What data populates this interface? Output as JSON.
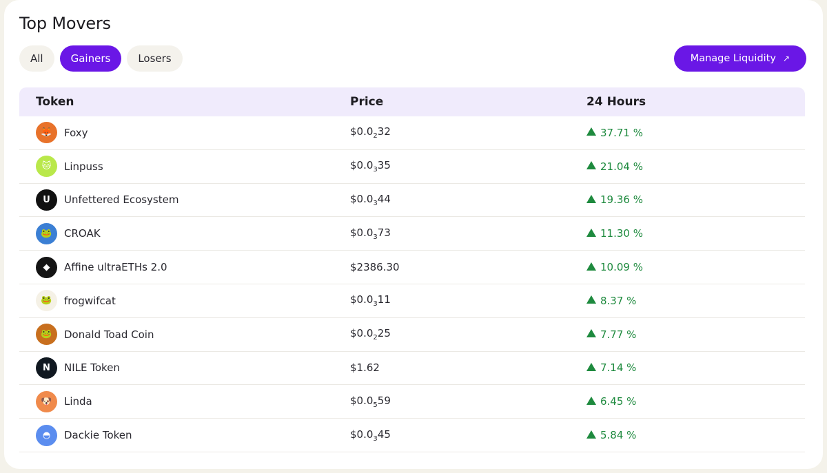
{
  "header": {
    "title": "Top Movers"
  },
  "tabs": [
    {
      "label": "All",
      "active": false
    },
    {
      "label": "Gainers",
      "active": true
    },
    {
      "label": "Losers",
      "active": false
    }
  ],
  "manage_button": {
    "label": "Manage Liquidity",
    "icon": "arrow-up-right-icon"
  },
  "table": {
    "headers": {
      "token": "Token",
      "price": "Price",
      "change": "24 Hours"
    },
    "rows": [
      {
        "name": "Foxy",
        "price_prefix": "$0.0",
        "price_zeros": "2",
        "price_digits": "32",
        "change": "37.71 %",
        "avatar_color": "#e8722a",
        "avatar_glyph": "🦊"
      },
      {
        "name": "Linpuss",
        "price_prefix": "$0.0",
        "price_zeros": "3",
        "price_digits": "35",
        "change": "21.04 %",
        "avatar_color": "#b9e84a",
        "avatar_glyph": "🐱"
      },
      {
        "name": "Unfettered Ecosystem",
        "price_prefix": "$0.0",
        "price_zeros": "3",
        "price_digits": "44",
        "change": "19.36 %",
        "avatar_color": "#111111",
        "avatar_glyph": "U"
      },
      {
        "name": "CROAK",
        "price_prefix": "$0.0",
        "price_zeros": "3",
        "price_digits": "73",
        "change": "11.30 %",
        "avatar_color": "#3b7fd4",
        "avatar_glyph": "🐸"
      },
      {
        "name": "Affine ultraETHs 2.0",
        "price_prefix": "$2386.30",
        "price_zeros": "",
        "price_digits": "",
        "change": "10.09 %",
        "avatar_color": "#141414",
        "avatar_glyph": "◆"
      },
      {
        "name": "frogwifcat",
        "price_prefix": "$0.0",
        "price_zeros": "3",
        "price_digits": "11",
        "change": "8.37 %",
        "avatar_color": "#f5f1e6",
        "avatar_glyph": "🐸"
      },
      {
        "name": "Donald Toad Coin",
        "price_prefix": "$0.0",
        "price_zeros": "2",
        "price_digits": "25",
        "change": "7.77 %",
        "avatar_color": "#c86f1e",
        "avatar_glyph": "🐸"
      },
      {
        "name": "NILE Token",
        "price_prefix": "$1.62",
        "price_zeros": "",
        "price_digits": "",
        "change": "7.14 %",
        "avatar_color": "#101820",
        "avatar_glyph": "N"
      },
      {
        "name": "Linda",
        "price_prefix": "$0.0",
        "price_zeros": "5",
        "price_digits": "59",
        "change": "6.45 %",
        "avatar_color": "#f08a4b",
        "avatar_glyph": "🐶"
      },
      {
        "name": "Dackie Token",
        "price_prefix": "$0.0",
        "price_zeros": "3",
        "price_digits": "45",
        "change": "5.84 %",
        "avatar_color": "#5b8def",
        "avatar_glyph": "◓"
      }
    ]
  },
  "colors": {
    "accent": "#6a17e6",
    "positive": "#1e8a3e",
    "header_bg": "#f0ebfc"
  }
}
